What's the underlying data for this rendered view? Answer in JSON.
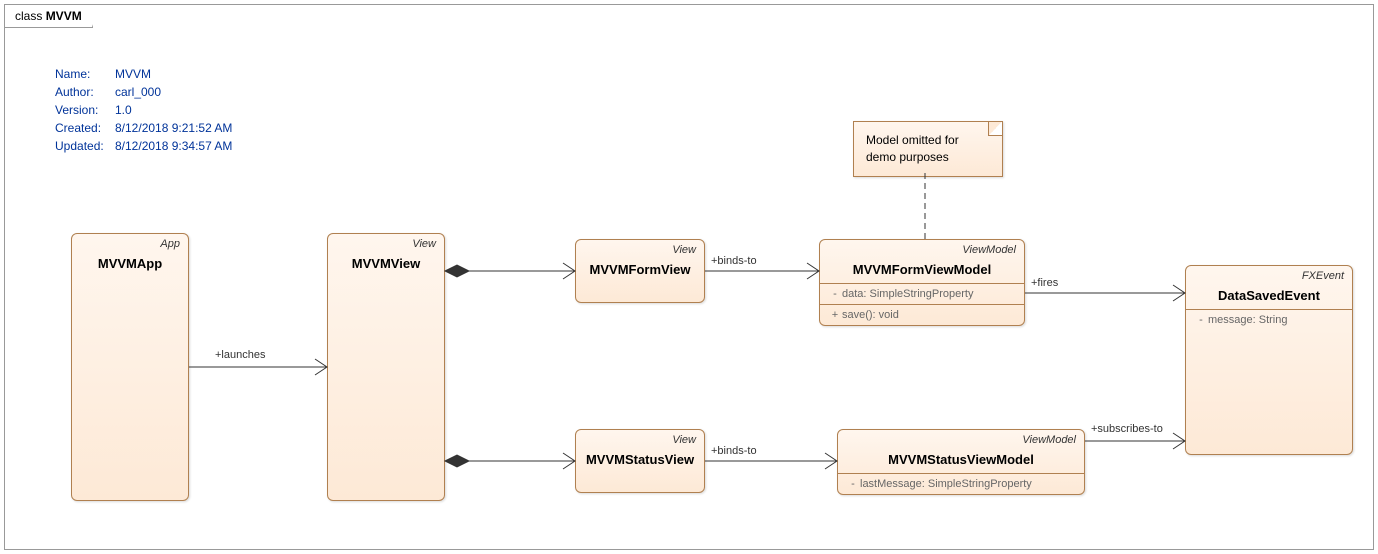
{
  "frame": {
    "type_label": "class",
    "name": "MVVM"
  },
  "meta": {
    "name_label": "Name:",
    "name": "MVVM",
    "author_label": "Author:",
    "author": "carl_000",
    "version_label": "Version:",
    "version": "1.0",
    "created_label": "Created:",
    "created": "8/12/2018 9:21:52 AM",
    "updated_label": "Updated:",
    "updated": "8/12/2018 9:34:57 AM"
  },
  "note": {
    "line1": "Model omitted for",
    "line2": "demo purposes"
  },
  "classes": {
    "app": {
      "stereo": "App",
      "name": "MVVMApp"
    },
    "view": {
      "stereo": "View",
      "name": "MVVMView"
    },
    "formview": {
      "stereo": "View",
      "name": "MVVMFormView"
    },
    "statusview": {
      "stereo": "View",
      "name": "MVVMStatusView"
    },
    "formvm": {
      "stereo": "ViewModel",
      "name": "MVVMFormViewModel",
      "attr_vis": "-",
      "attr": "data: SimpleStringProperty",
      "op_vis": "+",
      "op": "save(): void"
    },
    "statusvm": {
      "stereo": "ViewModel",
      "name": "MVVMStatusViewModel",
      "attr_vis": "-",
      "attr": "lastMessage: SimpleStringProperty"
    },
    "event": {
      "stereo": "FXEvent",
      "name": "DataSavedEvent",
      "attr_vis": "-",
      "attr": "message: String"
    }
  },
  "labels": {
    "launches": "+launches",
    "binds1": "+binds-to",
    "binds2": "+binds-to",
    "fires": "+fires",
    "subscribes": "+subscribes-to"
  }
}
